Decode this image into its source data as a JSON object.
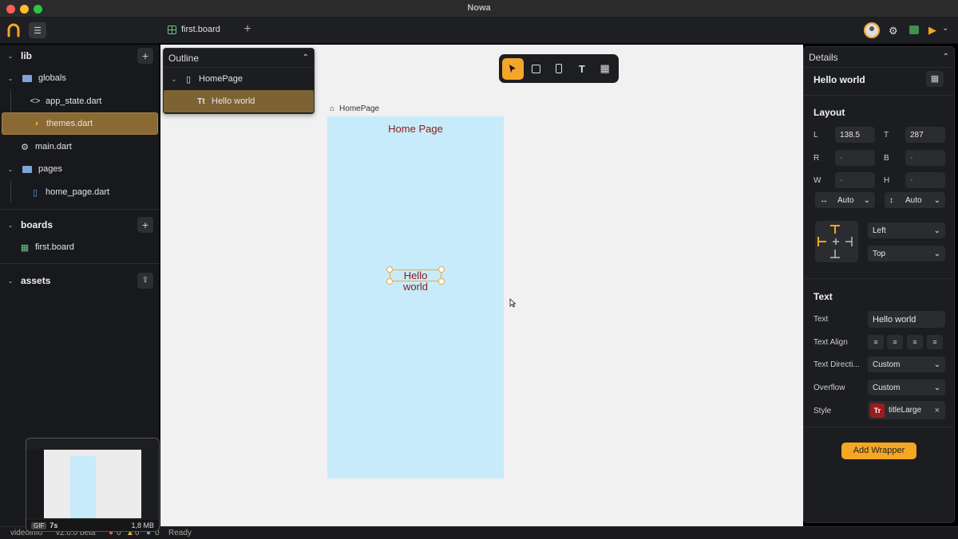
{
  "window": {
    "title": "Nowa"
  },
  "topbar": {
    "board_tab": "first.board"
  },
  "sidebar": {
    "lib_label": "lib",
    "items": [
      {
        "label": "globals"
      },
      {
        "label": "app_state.dart"
      },
      {
        "label": "themes.dart"
      },
      {
        "label": "main.dart"
      },
      {
        "label": "pages"
      },
      {
        "label": "home_page.dart"
      }
    ],
    "boards_label": "boards",
    "board_item": "first.board",
    "assets_label": "assets"
  },
  "outline": {
    "title": "Outline",
    "page": "HomePage",
    "child": "Hello world"
  },
  "canvas": {
    "breadcrumb": "HomePage",
    "page_title": "Home Page",
    "hello_text": "Hello world"
  },
  "details": {
    "title": "Details",
    "widget": "Hello world",
    "layout_heading": "Layout",
    "l_label": "L",
    "l_value": "138.5",
    "t_label": "T",
    "t_value": "287",
    "r_label": "R",
    "r_value": "-",
    "b_label": "B",
    "b_value": "-",
    "w_label": "W",
    "w_value": "-",
    "h_label": "H",
    "h_value": "-",
    "width_mode": "Auto",
    "height_mode": "Auto",
    "h_align": "Left",
    "v_align": "Top",
    "text_heading": "Text",
    "text_label": "Text",
    "text_value": "Hello world",
    "align_label": "Text Align",
    "direction_label": "Text Directi...",
    "direction_value": "Custom",
    "overflow_label": "Overflow",
    "overflow_value": "Custom",
    "style_label": "Style",
    "style_value": "titleLarge",
    "add_wrapper": "Add Wrapper"
  },
  "status": {
    "left": "videoinfo",
    "version": "v2.0.0 beta",
    "errors": "0",
    "warnings": "0",
    "infos": "0",
    "ready": "Ready",
    "gif_tag": "GIF",
    "gif_duration": "7s",
    "gif_size": "1,8 MB"
  },
  "colors": {
    "accent": "#f5a623",
    "selection": "#8a6a34",
    "canvas_bg": "#c7ebfb",
    "text_red": "#8b1a1a"
  }
}
